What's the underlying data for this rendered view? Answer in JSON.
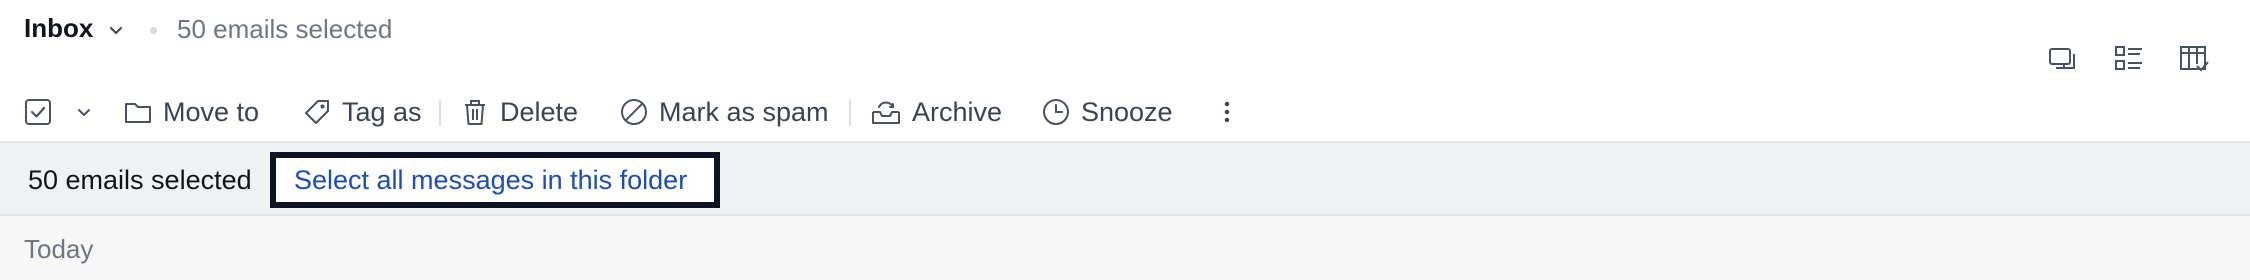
{
  "header": {
    "title": "Inbox",
    "selection_text": "50 emails selected",
    "title_chevron_icon": "chevron-down-icon",
    "view_icons": [
      "reading-pane-icon",
      "list-view-icon",
      "column-settings-icon"
    ]
  },
  "toolbar": {
    "select_checkbox_icon": "checkbox-checked-icon",
    "select_chevron_icon": "chevron-down-icon",
    "actions": [
      {
        "label": "Move to",
        "icon": "folder-icon"
      },
      {
        "label": "Tag as",
        "icon": "tag-icon"
      },
      {
        "label": "Delete",
        "icon": "trash-icon"
      },
      {
        "label": "Mark as spam",
        "icon": "block-icon"
      },
      {
        "label": "Archive",
        "icon": "archive-icon"
      },
      {
        "label": "Snooze",
        "icon": "clock-icon"
      }
    ],
    "more_icon": "more-vertical-icon"
  },
  "banner": {
    "selected_text": "50 emails selected",
    "select_all_link": "Select all messages in this folder"
  },
  "list": {
    "group_label": "Today"
  },
  "colors": {
    "link": "#1c4cb6",
    "focus_ring": "#0c1424",
    "banner_bg": "#f0f1f3",
    "icon": "#4a5160"
  }
}
